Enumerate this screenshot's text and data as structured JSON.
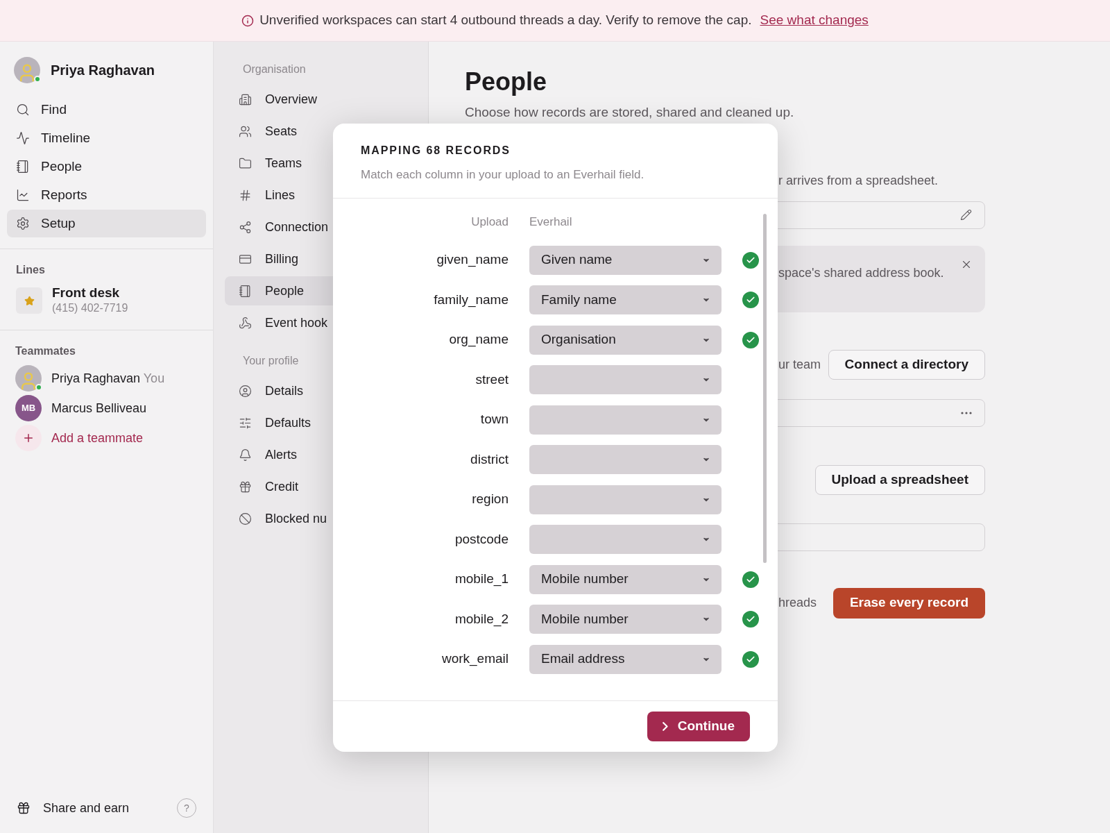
{
  "banner": {
    "text": "Unverified workspaces can start 4 outbound threads a day. Verify to remove the cap.",
    "link": "See what changes"
  },
  "sidebar": {
    "user": {
      "name": "Priya Raghavan",
      "online": true
    },
    "nav": [
      {
        "label": "Find",
        "selected": false
      },
      {
        "label": "Timeline",
        "selected": false
      },
      {
        "label": "People",
        "selected": false
      },
      {
        "label": "Reports",
        "selected": false
      },
      {
        "label": "Setup",
        "selected": true
      }
    ],
    "lines_heading": "Lines",
    "lines": [
      {
        "name": "Front desk",
        "number": "(415) 402-7719"
      }
    ],
    "teammates_heading": "Teammates",
    "teammates": [
      {
        "kind": "photo",
        "name": "Priya Raghavan",
        "tag": "You",
        "online": true
      },
      {
        "kind": "initials",
        "initials": "MB",
        "name": "Marcus Belliveau",
        "online": false
      }
    ],
    "add_teammate": "Add a teammate",
    "footer": {
      "label": "Share and earn",
      "help": "?"
    }
  },
  "settings_nav": {
    "sections": [
      {
        "heading": "Organisation",
        "items": [
          {
            "label": "Overview",
            "selected": false
          },
          {
            "label": "Seats",
            "selected": false
          },
          {
            "label": "Teams",
            "selected": false
          },
          {
            "label": "Lines",
            "selected": false
          },
          {
            "label": "Connection",
            "selected": false
          },
          {
            "label": "Billing",
            "selected": false
          },
          {
            "label": "People",
            "selected": true
          },
          {
            "label": "Event hook",
            "selected": false
          }
        ]
      },
      {
        "heading": "Your profile",
        "items": [
          {
            "label": "Details",
            "selected": false
          },
          {
            "label": "Defaults",
            "selected": false
          },
          {
            "label": "Alerts",
            "selected": false
          },
          {
            "label": "Credit",
            "selected": false
          },
          {
            "label": "Blocked nu",
            "selected": false
          }
        ]
      }
    ]
  },
  "page": {
    "title": "People",
    "subtitle": "Choose how records are stored, shared and cleaned up.",
    "fragment_1": "r arrives from a spreadsheet.",
    "notice": "space's shared address book.",
    "fragment_2": "ur team",
    "connect_button": "Connect a directory",
    "upload_button": "Upload a spreadsheet",
    "fragment_3": "hreads",
    "erase_button": "Erase every record"
  },
  "modal": {
    "title": "MAPPING 68 RECORDS",
    "subtitle": "Match each column in your upload to an Everhail field.",
    "columns": [
      "Upload",
      "Everhail"
    ],
    "rows": [
      {
        "field": "given_name",
        "value": "Given name",
        "matched": true
      },
      {
        "field": "family_name",
        "value": "Family name",
        "matched": true
      },
      {
        "field": "org_name",
        "value": "Organisation",
        "matched": true
      },
      {
        "field": "street",
        "matched": false
      },
      {
        "field": "town",
        "matched": false
      },
      {
        "field": "district",
        "matched": false
      },
      {
        "field": "region",
        "matched": false
      },
      {
        "field": "postcode",
        "matched": false
      },
      {
        "field": "mobile_1",
        "value": "Mobile number",
        "matched": true
      },
      {
        "field": "mobile_2",
        "value": "Mobile number",
        "matched": true
      },
      {
        "field": "work_email",
        "value": "Email address",
        "matched": true
      }
    ],
    "continue_button": "Continue"
  }
}
